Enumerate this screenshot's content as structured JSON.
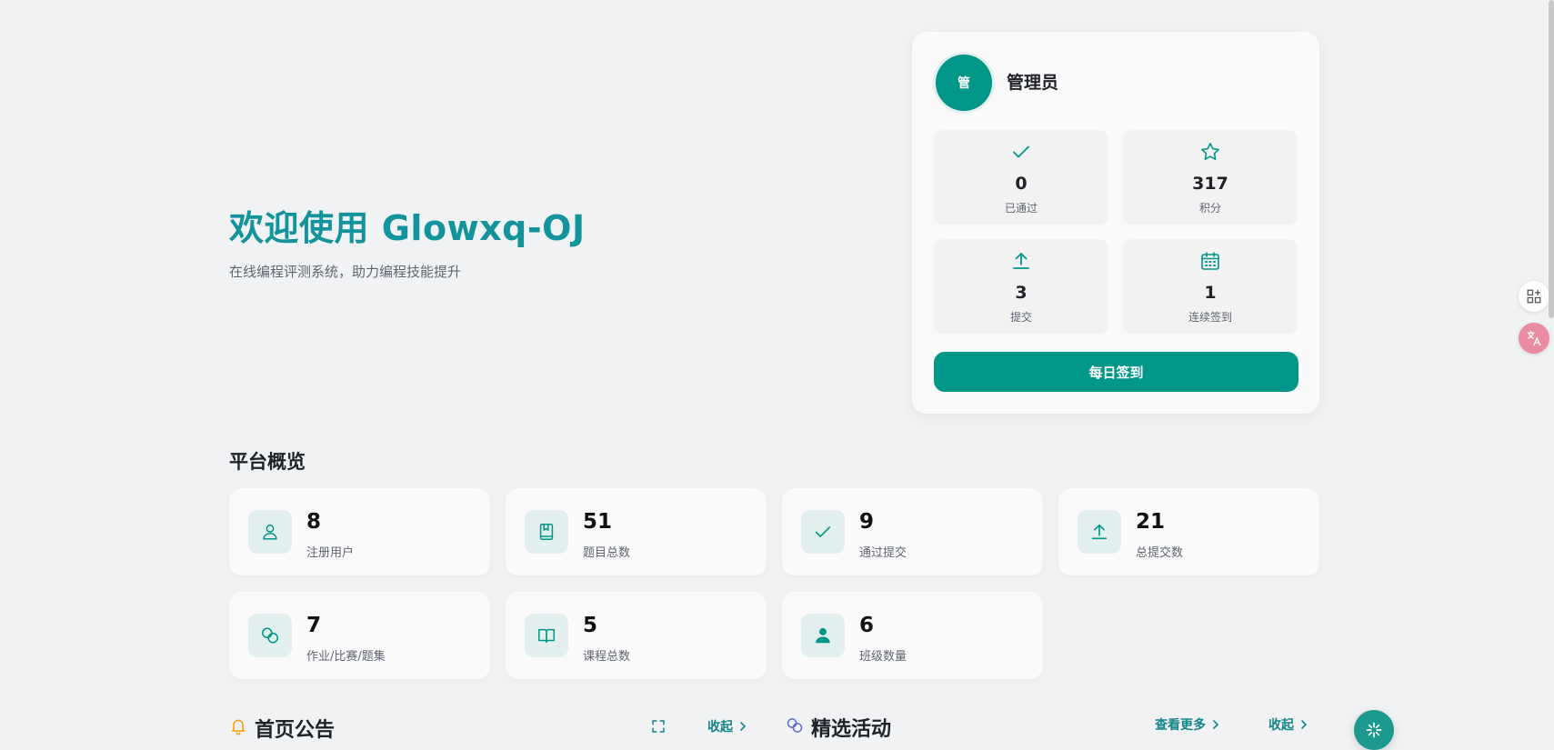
{
  "hero": {
    "title": "欢迎使用 Glowxq-OJ",
    "subtitle": "在线编程评测系统，助力编程技能提升"
  },
  "user_card": {
    "avatar_text": "管",
    "name": "管理员",
    "stats": [
      {
        "icon": "check-icon",
        "value": "0",
        "label": "已通过"
      },
      {
        "icon": "star-icon",
        "value": "317",
        "label": "积分"
      },
      {
        "icon": "upload-icon",
        "value": "3",
        "label": "提交"
      },
      {
        "icon": "calendar-icon",
        "value": "1",
        "label": "连续签到"
      }
    ],
    "checkin_label": "每日签到"
  },
  "overview": {
    "title": "平台概览",
    "cards": [
      {
        "icon": "user-icon",
        "value": "8",
        "label": "注册用户"
      },
      {
        "icon": "book-icon",
        "value": "51",
        "label": "题目总数"
      },
      {
        "icon": "check-icon",
        "value": "9",
        "label": "通过提交"
      },
      {
        "icon": "upload-icon",
        "value": "21",
        "label": "总提交数"
      },
      {
        "icon": "link-icon",
        "value": "7",
        "label": "作业/比赛/题集"
      },
      {
        "icon": "open-book-icon",
        "value": "5",
        "label": "课程总数"
      },
      {
        "icon": "person-icon",
        "value": "6",
        "label": "班级数量"
      }
    ]
  },
  "announcements": {
    "title": "首页公告",
    "collapse_label": "收起"
  },
  "activities": {
    "title": "精选活动",
    "more_label": "查看更多",
    "collapse_label": "收起"
  },
  "colors": {
    "accent": "#009688",
    "hero_title": "#13939b",
    "bell": "#f59e0b"
  }
}
